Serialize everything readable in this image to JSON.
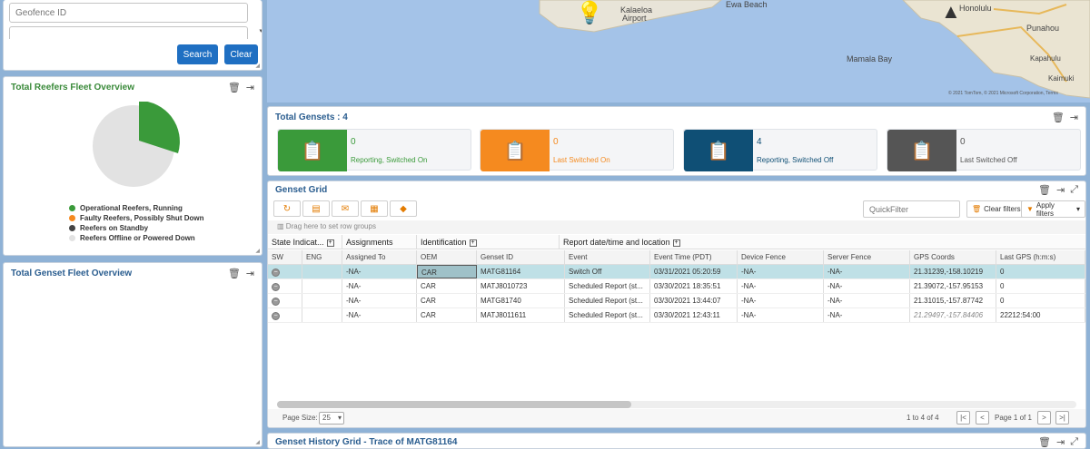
{
  "search": {
    "geofence_placeholder": "Geofence ID",
    "second_field_value": "",
    "search_label": "Search",
    "clear_label": "Clear"
  },
  "reefers": {
    "title": "Total Reefers Fleet Overview",
    "legend": [
      {
        "label": "Operational Reefers, Running",
        "color": "#3a9a3a"
      },
      {
        "label": "Faulty Reefers, Possibly Shut Down",
        "color": "#f58a1f"
      },
      {
        "label": "Reefers on Standby",
        "color": "#444444"
      },
      {
        "label": "Reefers Offline or Powered Down",
        "color": "#e2e2e2"
      }
    ]
  },
  "genset_overview": {
    "title": "Total Genset Fleet Overview"
  },
  "map": {
    "labels": [
      "Kalaeloa",
      "Airport",
      "Ewa Beach",
      "Mamala Bay",
      "Punahou",
      "Honolulu",
      "Kapahulu",
      "Kaimuki"
    ],
    "copyright": "© 2021 TomTom, © 2021 Microsoft Corporation, Terms"
  },
  "gensets": {
    "title": "Total Gensets : 4",
    "cards": [
      {
        "count": "0",
        "label": "Reporting, Switched On",
        "color": "#3a9a3a"
      },
      {
        "count": "0",
        "label": "Last Switched On",
        "color": "#f58a1f"
      },
      {
        "count": "4",
        "label": "Reporting, Switched Off",
        "color": "#0f4f75"
      },
      {
        "count": "0",
        "label": "Last Switched Off",
        "color": "#555555"
      }
    ]
  },
  "grid": {
    "title": "Genset Grid",
    "quickfilter_placeholder": "QuickFilter",
    "clear_filters_label": "Clear filters",
    "apply_filters_label": "Apply filters",
    "group_hint": "Drag here to set row groups",
    "group_headers": [
      "State Indicat...",
      "Assignments",
      "Identification",
      "Report date/time and location"
    ],
    "columns": [
      "SW",
      "ENG",
      "Assigned To",
      "OEM",
      "Genset ID",
      "Event",
      "Event Time (PDT)",
      "Device Fence",
      "Server Fence",
      "GPS Coords",
      "Last GPS (h:m:s)"
    ],
    "rows": [
      {
        "assigned": "-NA-",
        "oem": "CAR",
        "genset_id": "MATG81164",
        "event": "Switch Off",
        "time": "03/31/2021 05:20:59",
        "device_fence": "-NA-",
        "server_fence": "-NA-",
        "gps": "21.31239,-158.10219",
        "last_gps": "0"
      },
      {
        "assigned": "-NA-",
        "oem": "CAR",
        "genset_id": "MATJ8010723",
        "event": "Scheduled Report (st...",
        "time": "03/30/2021 18:35:51",
        "device_fence": "-NA-",
        "server_fence": "-NA-",
        "gps": "21.39072,-157.95153",
        "last_gps": "0"
      },
      {
        "assigned": "-NA-",
        "oem": "CAR",
        "genset_id": "MATG81740",
        "event": "Scheduled Report (st...",
        "time": "03/30/2021 13:44:07",
        "device_fence": "-NA-",
        "server_fence": "-NA-",
        "gps": "21.31015,-157.87742",
        "last_gps": "0"
      },
      {
        "assigned": "-NA-",
        "oem": "CAR",
        "genset_id": "MATJ8011611",
        "event": "Scheduled Report (st...",
        "time": "03/30/2021 12:43:11",
        "device_fence": "-NA-",
        "server_fence": "-NA-",
        "gps": "21.29497,-157.84406",
        "last_gps": "22212:54:00"
      }
    ],
    "page_size_label": "Page Size:",
    "page_size_value": "25",
    "range_text": "1 to 4 of 4",
    "page_text": "Page 1 of 1"
  },
  "history": {
    "title": "Genset History Grid - Trace of MATG81164"
  }
}
